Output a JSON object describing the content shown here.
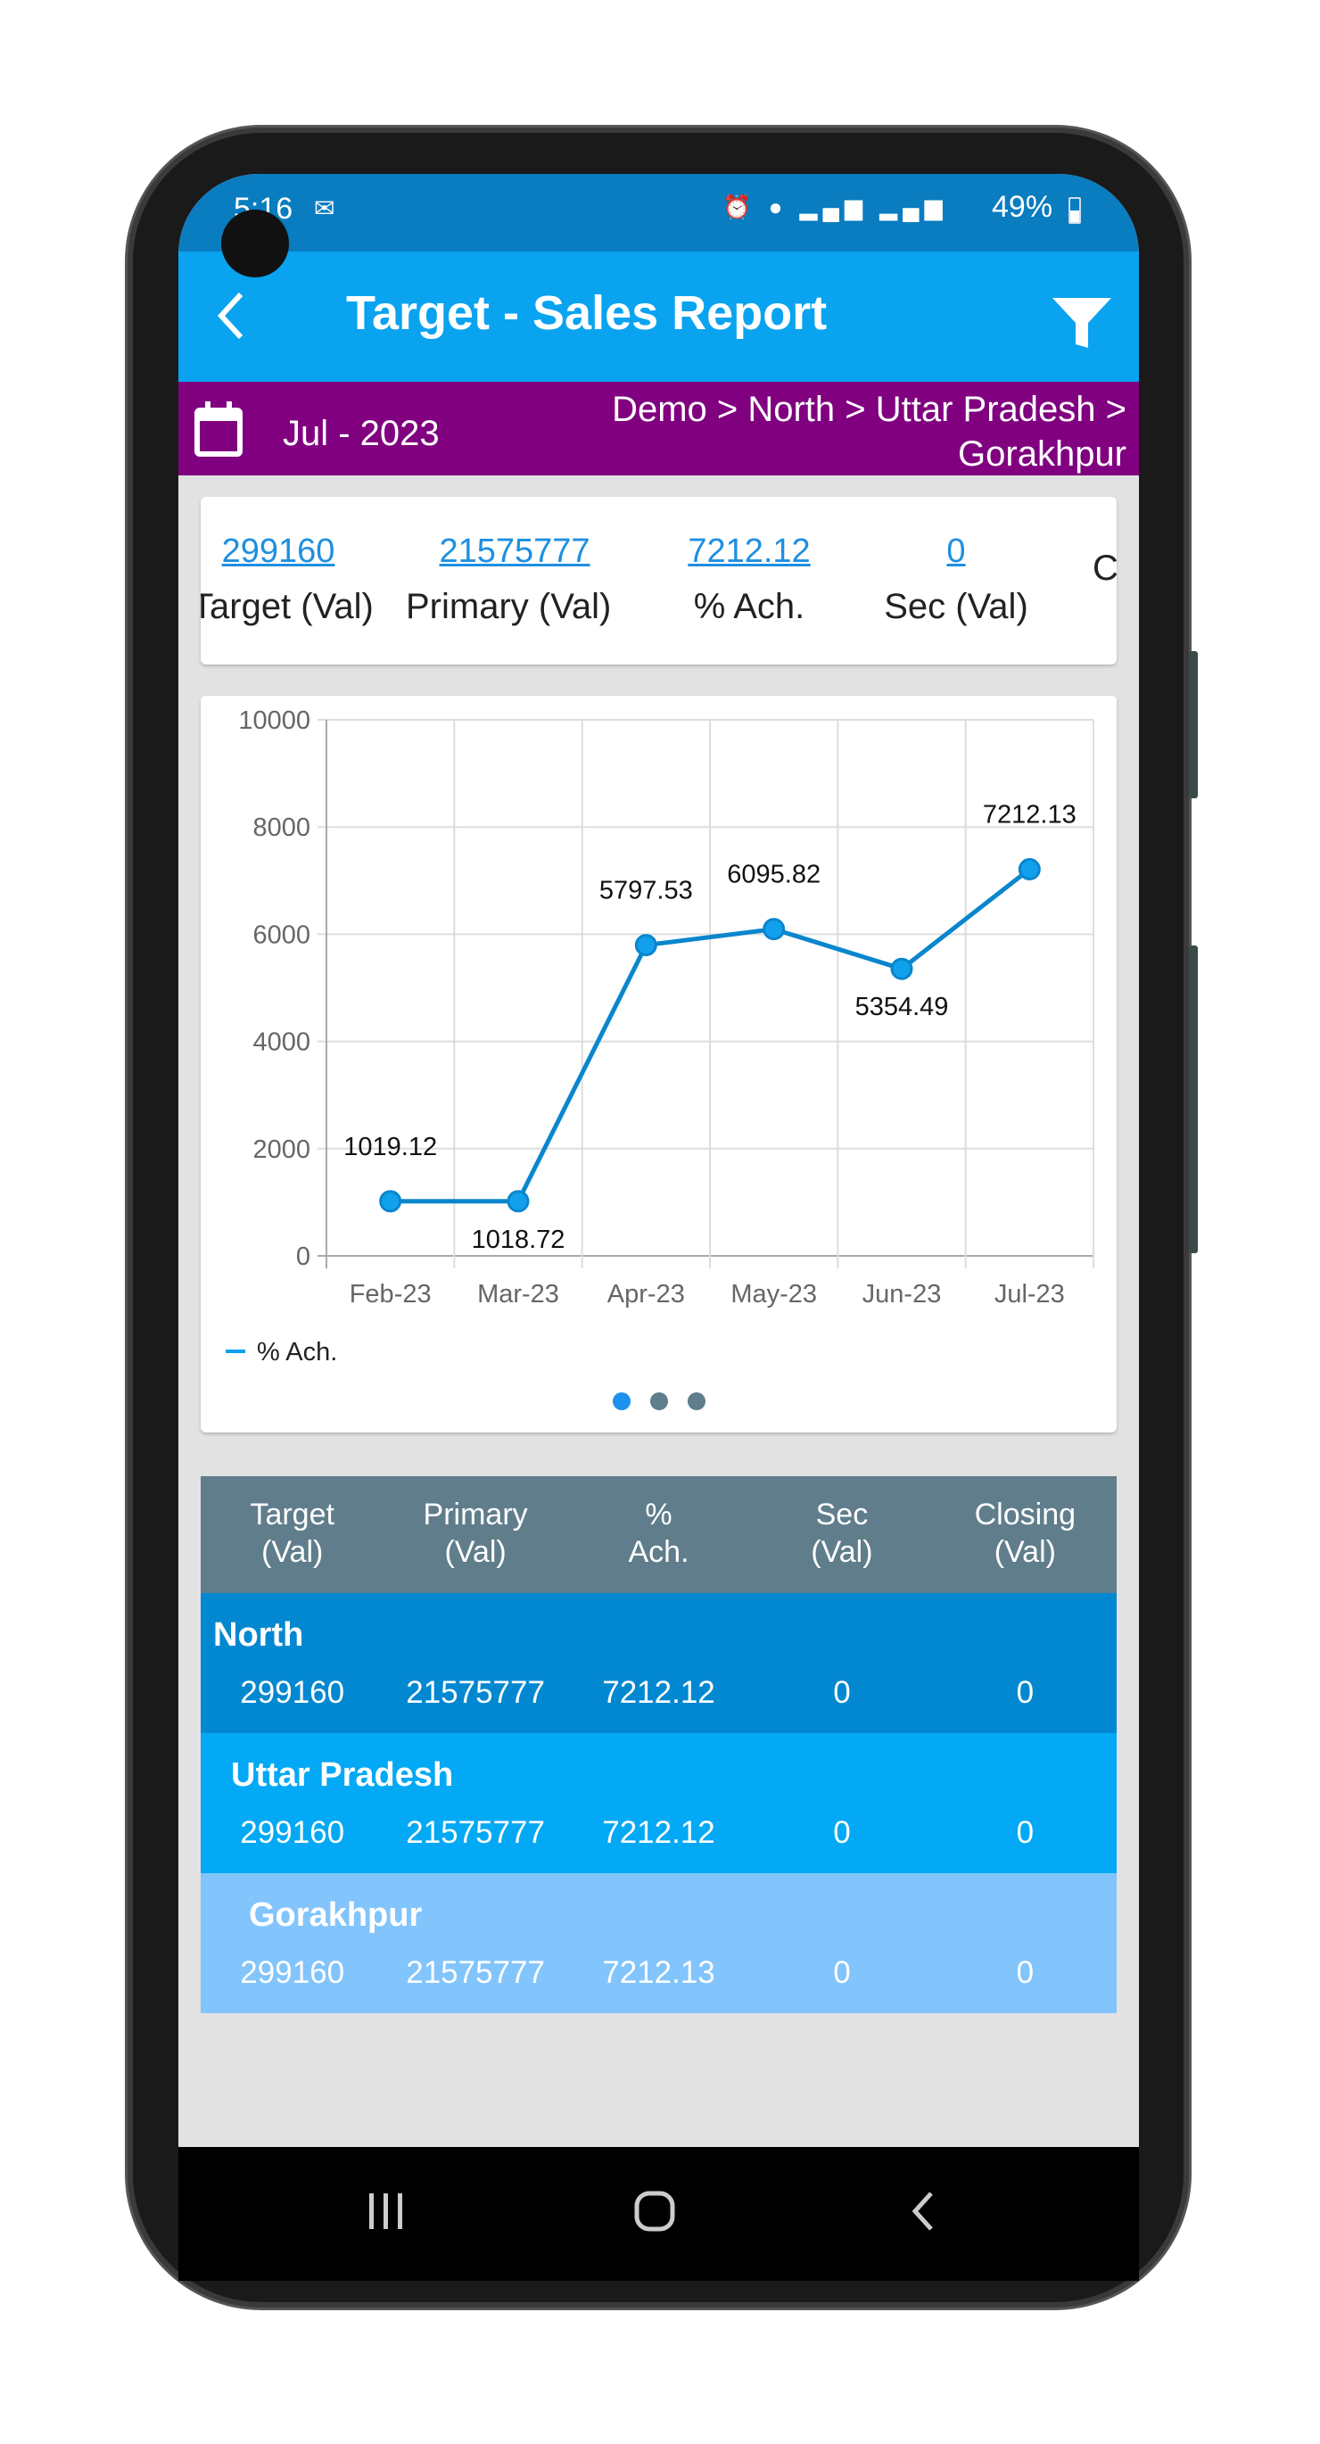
{
  "status_bar": {
    "time": "5:16",
    "battery": "49%",
    "icons": [
      "outlook-icon",
      "alarm-icon",
      "location-icon",
      "volte-lte1-signal-icon",
      "volte-lte2-signal-icon",
      "battery-icon"
    ]
  },
  "header": {
    "title": "Target - Sales Report",
    "back_icon": "chevron-left-icon",
    "filter_icon": "filter-icon"
  },
  "context": {
    "period": "Jul - 2023",
    "breadcrumb_line1": "Demo > North > Uttar Pradesh >",
    "breadcrumb_line2": "Gorakhpur",
    "colors": {
      "bar": "#800080"
    }
  },
  "summary": [
    {
      "value": "299160",
      "label": "Target (Val)"
    },
    {
      "value": "21575777",
      "label": "Primary (Val)"
    },
    {
      "value": "7212.12",
      "label": "% Ach."
    },
    {
      "value": "0",
      "label": "Sec (Val)"
    },
    {
      "value": "",
      "label": "C"
    }
  ],
  "chart_data": {
    "type": "line",
    "categories": [
      "Feb-23",
      "Mar-23",
      "Apr-23",
      "May-23",
      "Jun-23",
      "Jul-23"
    ],
    "series": [
      {
        "name": "% Ach.",
        "values": [
          1019.12,
          1018.72,
          5797.53,
          6095.82,
          5354.49,
          7212.13
        ],
        "color": "#0a86cc"
      }
    ],
    "data_labels": [
      "1019.12",
      "1018.72",
      "5797.53",
      "6095.82",
      "5354.49",
      "7212.13"
    ],
    "ylim": [
      0,
      10000
    ],
    "yticks": [
      "0",
      "2000",
      "4000",
      "6000",
      "8000",
      "10000"
    ],
    "grid": true,
    "legend": "bottom-left",
    "pager": {
      "pages": 3,
      "active": 0
    }
  },
  "table": {
    "headers": [
      [
        "Target",
        "(Val)"
      ],
      [
        "Primary",
        "(Val)"
      ],
      [
        "%",
        "Ach."
      ],
      [
        "Sec",
        "(Val)"
      ],
      [
        "Closing",
        "(Val)"
      ]
    ],
    "rows": [
      {
        "name": "North",
        "values": [
          "299160",
          "21575777",
          "7212.12",
          "0",
          "0"
        ],
        "color": "#0288d1"
      },
      {
        "name": "Uttar Pradesh",
        "values": [
          "299160",
          "21575777",
          "7212.12",
          "0",
          "0"
        ],
        "color": "#03a9f4"
      },
      {
        "name": "Gorakhpur",
        "values": [
          "299160",
          "21575777",
          "7212.13",
          "0",
          "0"
        ],
        "color": "#82c4fc"
      }
    ]
  },
  "nav": {
    "icons": [
      "recent-apps-icon",
      "home-icon",
      "back-icon"
    ]
  }
}
